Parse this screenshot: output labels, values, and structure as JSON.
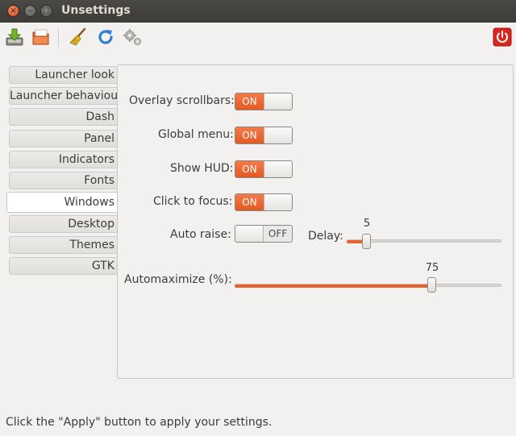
{
  "window": {
    "title": "Unsettings",
    "close_glyph": "×",
    "minimize_glyph": "–",
    "maximize_glyph": "□"
  },
  "toolbar": {
    "items": [
      {
        "icon": "save-download-icon"
      },
      {
        "icon": "open-folder-icon"
      },
      {
        "icon": "broom-clean-icon"
      },
      {
        "icon": "refresh-icon"
      },
      {
        "icon": "gears-settings-icon"
      },
      {
        "icon": "power-quit-icon"
      }
    ]
  },
  "sidebar": {
    "items": [
      {
        "label": "Launcher look"
      },
      {
        "label": "Launcher behaviour"
      },
      {
        "label": "Dash"
      },
      {
        "label": "Panel"
      },
      {
        "label": "Indicators"
      },
      {
        "label": "Fonts"
      },
      {
        "label": "Windows"
      },
      {
        "label": "Desktop"
      },
      {
        "label": "Themes"
      },
      {
        "label": "GTK"
      }
    ],
    "active_index": 6
  },
  "windows_panel": {
    "overlay_scrollbars": {
      "label": "Overlay scrollbars:",
      "state": "ON"
    },
    "global_menu": {
      "label": "Global menu:",
      "state": "ON"
    },
    "show_hud": {
      "label": "Show HUD:",
      "state": "ON"
    },
    "click_to_focus": {
      "label": "Click to focus:",
      "state": "ON"
    },
    "auto_raise": {
      "label": "Auto raise:",
      "state": "OFF"
    },
    "delay": {
      "label": "Delay:",
      "value": "5",
      "fraction": 0.06
    },
    "automaximize": {
      "label": "Automaximize  (%):",
      "value": "75",
      "fraction": 0.75
    }
  },
  "status_bar": {
    "text": "Click the \"Apply\" button to apply your settings."
  },
  "colors": {
    "accent": "#e8622a",
    "titlebar": "#3c3b37",
    "window_bg": "#f2f1f0"
  }
}
